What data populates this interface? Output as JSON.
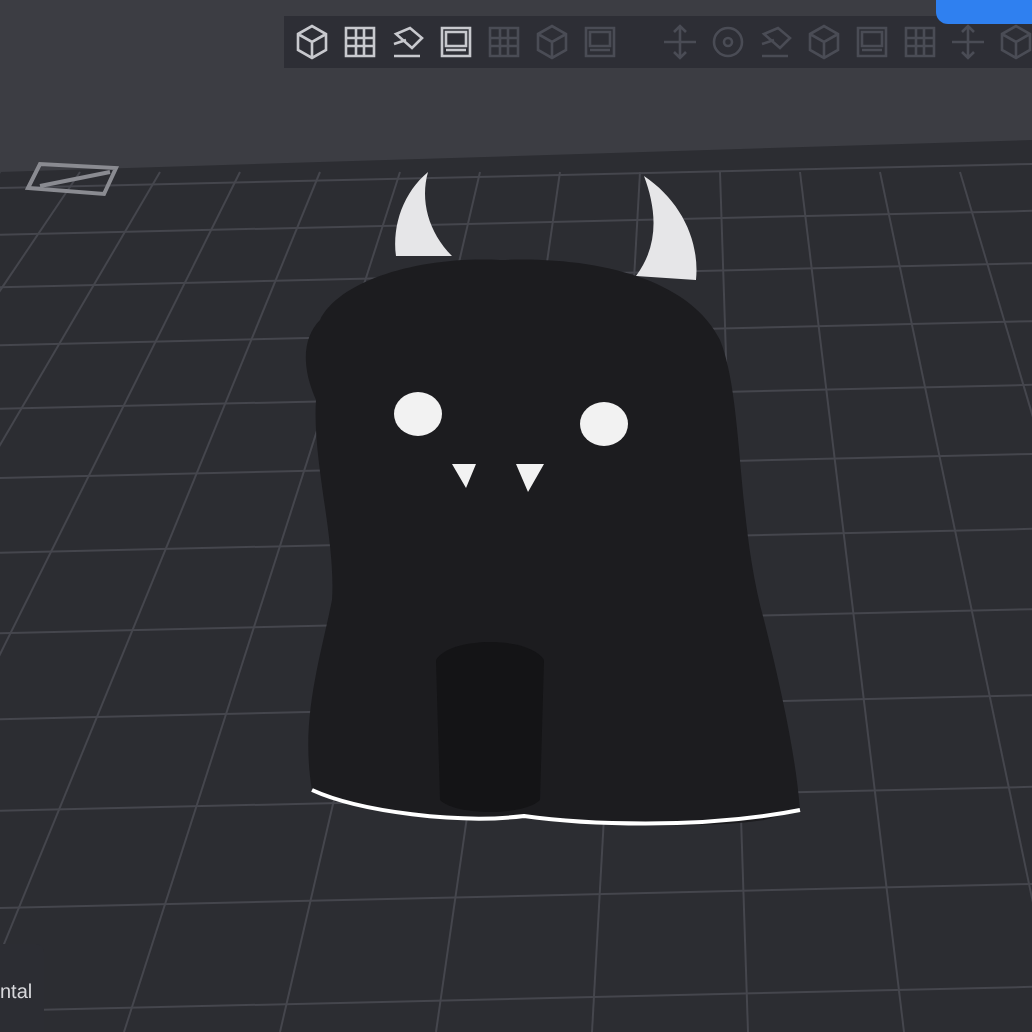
{
  "toolbar": {
    "groups": [
      [
        {
          "kind": "cube",
          "disabled": false
        },
        {
          "kind": "grid",
          "disabled": false
        },
        {
          "kind": "arrange",
          "disabled": false
        },
        {
          "kind": "plate",
          "disabled": false
        },
        {
          "kind": "grid",
          "disabled": true
        },
        {
          "kind": "cube",
          "disabled": true
        },
        {
          "kind": "plate",
          "disabled": true
        }
      ],
      [
        {
          "kind": "move",
          "disabled": true
        },
        {
          "kind": "rotate",
          "disabled": true
        },
        {
          "kind": "arrange",
          "disabled": true
        },
        {
          "kind": "cube",
          "disabled": true
        },
        {
          "kind": "plate",
          "disabled": true
        },
        {
          "kind": "grid",
          "disabled": true
        },
        {
          "kind": "move",
          "disabled": true
        },
        {
          "kind": "cube",
          "disabled": true
        }
      ]
    ]
  },
  "panel": {
    "label": "ntal"
  }
}
